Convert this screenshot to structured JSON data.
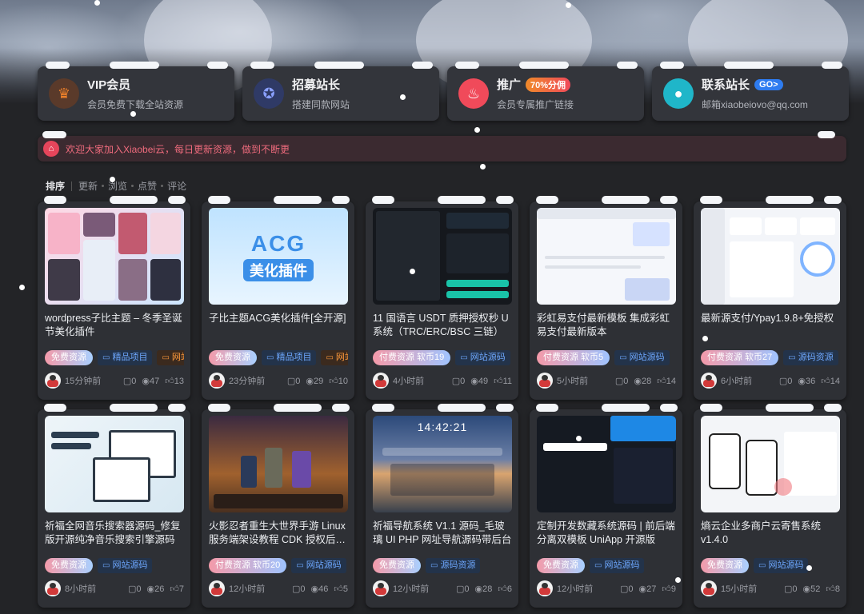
{
  "promo": [
    {
      "title": "VIP会员",
      "tag": "",
      "subtitle": "会员免费下载全站资源",
      "icon": "crown-icon",
      "color": "#f0822a"
    },
    {
      "title": "招募站长",
      "tag": "",
      "subtitle": "搭建同款网站",
      "icon": "badge-icon",
      "color": "#4b63c9"
    },
    {
      "title": "推广",
      "tag": "70%分佣",
      "subtitle": "会员专属推广链接",
      "icon": "flame-icon",
      "color": "#f04a5a"
    },
    {
      "title": "联系站长",
      "tag": "GO>",
      "subtitle": "邮箱xiaobeiovo@qq.com",
      "icon": "user-icon",
      "color": "#1fb6c9"
    }
  ],
  "notice": {
    "text": "欢迎大家加入Xiaobei云，每日更新资源，做到不断更",
    "icon": "home-icon"
  },
  "sort": {
    "label": "排序",
    "options": [
      "更新",
      "浏览",
      "点赞",
      "评论"
    ]
  },
  "cards": [
    {
      "title": "wordpress子比主题 – 冬季圣诞节美化插件",
      "price": "免费资源",
      "cats": [
        "精品项目",
        "网站源码"
      ],
      "time": "15分钟前",
      "comments": "0",
      "views": "47",
      "likes": "13"
    },
    {
      "title": "子比主题ACG美化插件[全开源]",
      "price": "免费资源",
      "cats": [
        "精品项目",
        "网站源码"
      ],
      "time": "23分钟前",
      "comments": "0",
      "views": "29",
      "likes": "10",
      "thumb_acg": "ACG",
      "thumb_cn": "美化插件"
    },
    {
      "title": "11 国语言 USDT 质押授权秒 U 系统（TRC/ERC/BSC 三链）",
      "price": "付费资源 软币19",
      "cats": [
        "网站源码",
        ""
      ],
      "time": "4小时前",
      "comments": "0",
      "views": "49",
      "likes": "11"
    },
    {
      "title": "彩虹易支付最新模板 集成彩虹易支付最新版本",
      "price": "付费资源 软币5",
      "cats": [
        "网站源码"
      ],
      "time": "5小时前",
      "comments": "0",
      "views": "28",
      "likes": "14"
    },
    {
      "title": "最新源支付/Ypay1.9.8+免授权",
      "price": "付费资源 软币27",
      "cats": [
        "源码资源"
      ],
      "time": "6小时前",
      "comments": "0",
      "views": "36",
      "likes": "14"
    },
    {
      "title": "祈福全网音乐搜索器源码_修复版开源纯净音乐搜索引擎源码",
      "price": "免费资源",
      "cats": [
        "网站源码"
      ],
      "time": "8小时前",
      "comments": "0",
      "views": "26",
      "likes": "7"
    },
    {
      "title": "火影忍者重生大世界手游 Linux 服务端架设教程 CDK 授权后…",
      "price": "付费资源 软币20",
      "cats": [
        "网站源码"
      ],
      "time": "12小时前",
      "comments": "0",
      "views": "46",
      "likes": "5"
    },
    {
      "title": "祈福导航系统 V1.1 源码_毛玻璃 UI PHP 网址导航源码带后台",
      "price": "免费资源",
      "cats": [
        "源码资源"
      ],
      "time": "12小时前",
      "comments": "0",
      "views": "28",
      "likes": "6",
      "thumb_clock": "14:42:21"
    },
    {
      "title": "定制开发数藏系统源码 | 前后端分离双模板 UniApp 开源版",
      "price": "免费资源",
      "cats": [
        "网站源码"
      ],
      "time": "12小时前",
      "comments": "0",
      "views": "27",
      "likes": "9"
    },
    {
      "title": "熵云企业多商户云寄售系统 v1.4.0",
      "price": "免费资源",
      "cats": [
        "网站源码"
      ],
      "time": "15小时前",
      "comments": "0",
      "views": "52",
      "likes": "8"
    }
  ]
}
